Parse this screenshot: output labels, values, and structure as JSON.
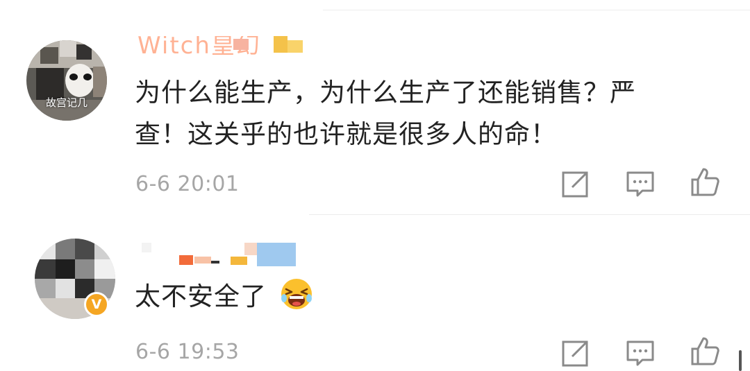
{
  "comments": [
    {
      "username": "Witch皇幻",
      "avatar_caption": "故宫记几",
      "text_lines": [
        "为什么能生产，为什么生产了还能销售？严",
        "查！这关乎的也许就是很多人的命！"
      ],
      "time": "6-6 20:01"
    },
    {
      "username": "",
      "text_lines": [
        "太不安全了"
      ],
      "emoji": "crying-laugh",
      "verified_badge": "V",
      "time": "6-6 19:53"
    }
  ],
  "colors": {
    "text": "#222222",
    "meta": "#a6a6a6",
    "icon": "#8a8a8a",
    "badge": "#f5a623"
  },
  "icons": [
    "share-icon",
    "comment-icon",
    "like-icon"
  ]
}
